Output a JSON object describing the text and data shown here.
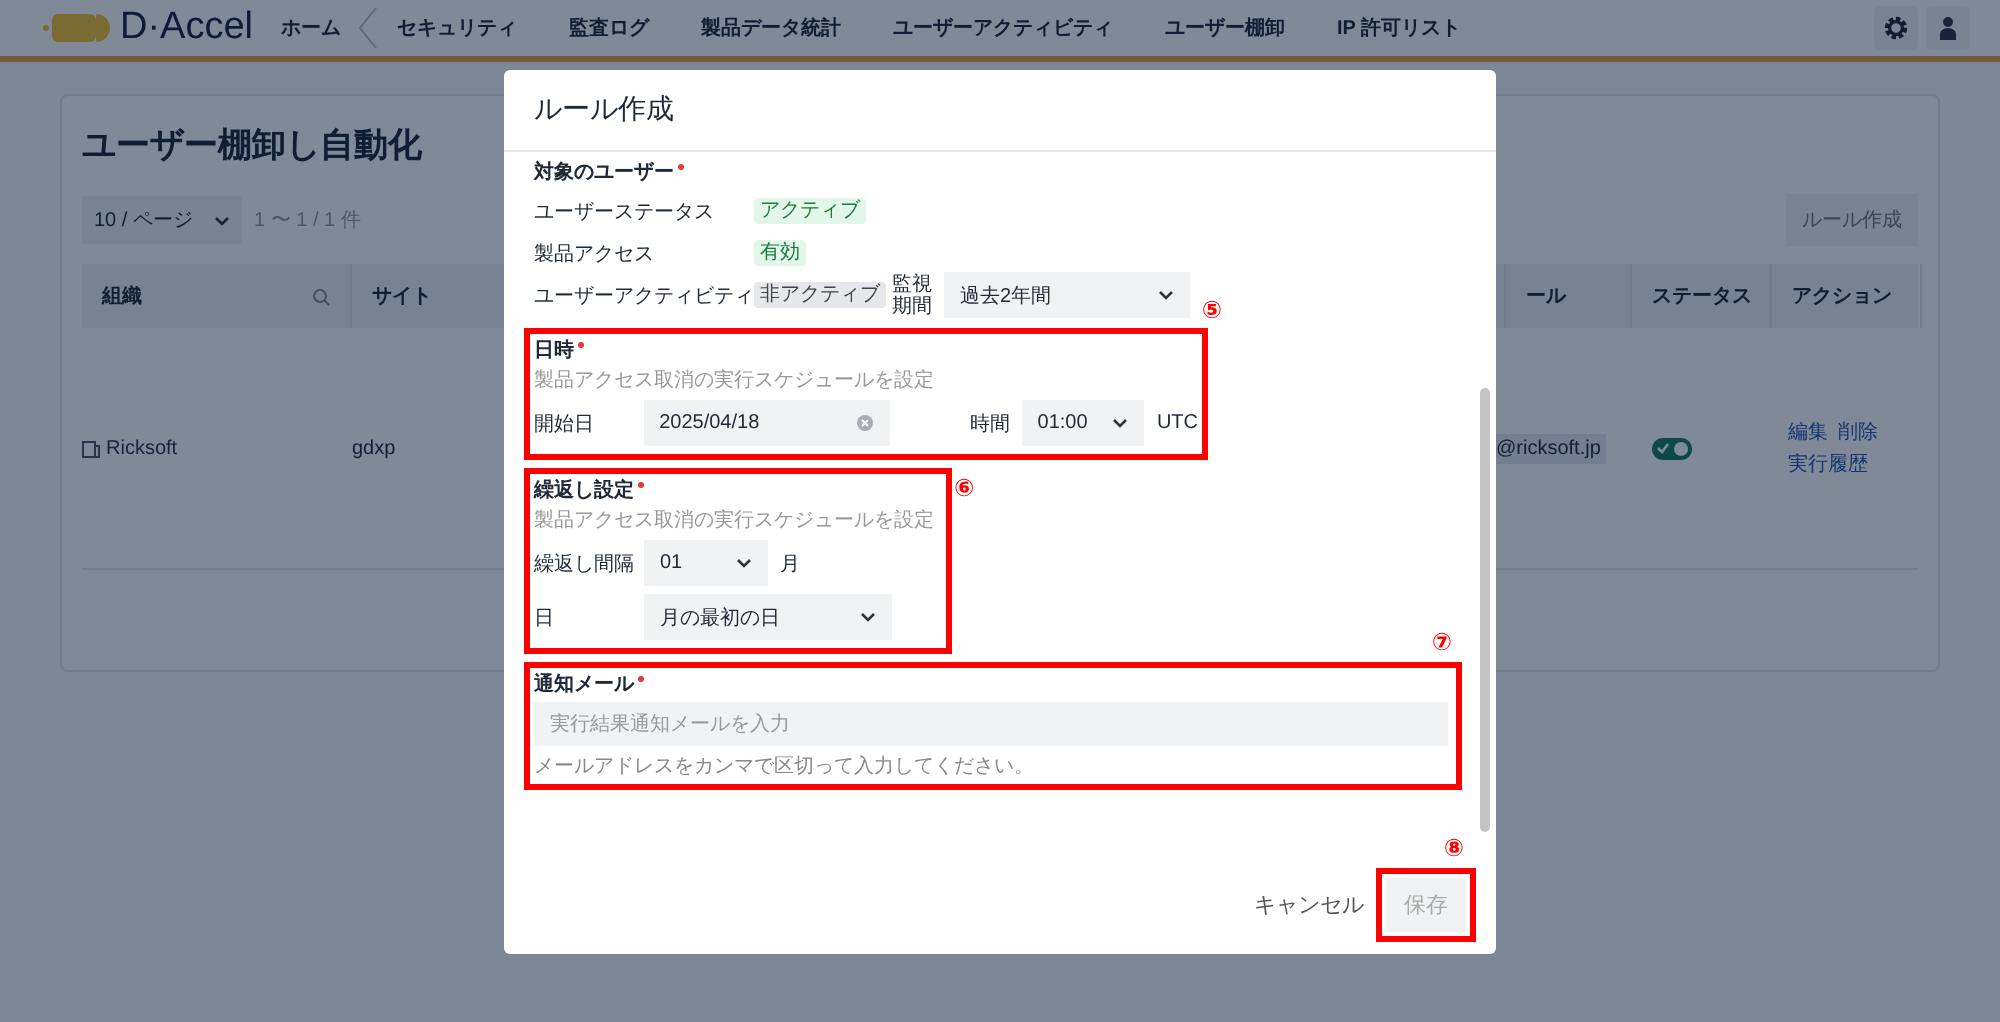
{
  "nav": {
    "logo": "D·Accel",
    "items": [
      "ホーム",
      "セキュリティ",
      "監査ログ",
      "製品データ統計",
      "ユーザーアクティビティ",
      "ユーザー棚卸",
      "IP 許可リスト"
    ]
  },
  "page": {
    "title": "ユーザー棚卸し自動化",
    "page_size": "10 / ページ",
    "range": "1 〜 1 / 1 件",
    "create_button": "ルール作成",
    "table": {
      "columns": [
        "組織",
        "サイト",
        "ール",
        "ステータス",
        "アクション"
      ],
      "rows": [
        {
          "org": "Ricksoft",
          "site": "gdxp",
          "column_3": "@ricksoft.jp",
          "status_on": true,
          "actions": [
            "編集",
            "削除",
            "実行履歴"
          ]
        }
      ]
    }
  },
  "modal": {
    "title": "ルール作成",
    "target_users": {
      "label": "対象のユーザー",
      "required": true,
      "rows": [
        {
          "label": "ユーザーステータス",
          "badge": "アクティブ",
          "kind": "positive"
        },
        {
          "label": "製品アクセス",
          "badge": "有効",
          "kind": "positive"
        },
        {
          "label": "ユーザーアクティビティ",
          "badge": "非アクティブ",
          "kind": "neutral"
        }
      ],
      "period_label": "監視期間",
      "period_value": "過去2年間"
    },
    "schedule": {
      "label": "日時",
      "required": true,
      "marker": "⑤",
      "hint": "製品アクセス取消の実行スケジュールを設定",
      "start_label": "開始日",
      "start_value": "2025/04/18",
      "time_label": "時間",
      "time_value": "01:00",
      "timezone": "UTC"
    },
    "repeat": {
      "label": "繰返し設定",
      "required": true,
      "marker": "⑥",
      "hint": "製品アクセス取消の実行スケジュールを設定",
      "interval_label": "繰返し間隔",
      "interval_value": "01",
      "unit": "月",
      "day_label": "日",
      "day_value": "月の最初の日"
    },
    "email": {
      "label": "通知メール",
      "required": true,
      "marker": "⑦",
      "placeholder": "実行結果通知メールを入力",
      "help": "メールアドレスをカンマで区切って入力してください。"
    },
    "cancel_button": "キャンセル",
    "save_button": {
      "label": "保存",
      "disabled": true,
      "marker": "⑧"
    }
  }
}
